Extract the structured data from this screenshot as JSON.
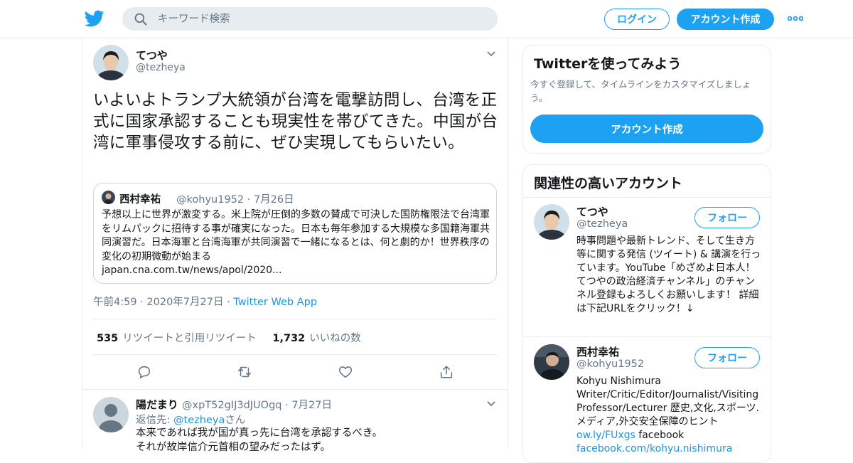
{
  "header": {
    "search_placeholder": "キーワード検索",
    "login": "ログイン",
    "signup": "アカウント作成"
  },
  "tweet": {
    "name": "てつや",
    "handle": "@tezheya",
    "text": "いよいよトランプ大統領が台湾を電撃訪問し、台湾を正式に国家承認することも現実性を帯びてきた。中国が台湾に軍事侵攻する前に、ぜひ実現してもらいたい。",
    "quote": {
      "name": "西村幸祐",
      "handle": "@kohyu1952",
      "date": "· 7月26日",
      "text": "予想以上に世界が激変する。米上院が圧倒的多数の賛成で可決した国防権限法で台湾軍をリムパックに招待する事が確実になった。日本も毎年参加する大規模な多国籍海軍共同演習だ。日本海軍と台湾海軍が共同演習で一緒になるとは、何と劇的か！世界秩序の変化の初期微動が始まる",
      "link": "japan.cna.com.tw/news/apol/2020..."
    },
    "time": "午前4:59 · 2020年7月27日 · ",
    "app": "Twitter Web App",
    "retweets": "535",
    "retweets_label": "リツイートと引用リツイート",
    "likes": "1,732",
    "likes_label": "いいねの数"
  },
  "reply": {
    "name": "陽だまり",
    "handle": "@xpT52gIJ3dJUOgq · 7月27日",
    "to_prefix": "返信先: ",
    "to_user": "@tezheya",
    "to_suffix": "さん",
    "text_line1": "本来であれば我が国が真っ先に台湾を承認するべき。",
    "text_line2": "それが故岸信介元首相の望みだったはず。"
  },
  "sidebar": {
    "try_title": "Twitterを使ってみよう",
    "try_sub": "今すぐ登録して、タイムラインをカスタマイズしましょう。",
    "try_button": "アカウント作成",
    "related_title": "関連性の高いアカウント",
    "follow_label": "フォロー",
    "accounts": [
      {
        "name": "てつや",
        "handle": "@tezheya",
        "bio": "時事問題や最新トレンド、そして生き方等に関する発信 (ツイート) & 講演を行っています。YouTube「めざめよ日本人！てつやの政治経済チャンネル」のチャンネル登録もよろしくお願いします！ 詳細は下記URLをクリック！↓"
      },
      {
        "name": "西村幸祐",
        "handle": "@kohyu1952",
        "bio": "Kohyu Nishimura Writer/Critic/Editor/Journalist/Visiting Professor/Lecturer 歴史,文化,スポーツ.メディア,外交安全保障のヒント ",
        "bio_link": "ow.ly/FUxgs",
        "bio_after": " facebook",
        "bio_link2": "facebook.com/kohyu.nishimura"
      }
    ]
  },
  "colors": {
    "accent": "#1da1f2",
    "link": "#1b95e0",
    "muted": "#657786",
    "border": "#e6ecf0"
  },
  "icons": [
    "twitter-bird-icon",
    "search-icon",
    "more-dots-icon",
    "chevron-down-icon",
    "reply-icon",
    "retweet-icon",
    "like-icon",
    "share-icon",
    "default-avatar-icon"
  ]
}
